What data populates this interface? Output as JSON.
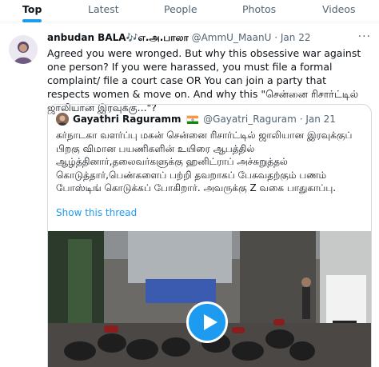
{
  "tabs": [
    {
      "label": "Top",
      "active": true
    },
    {
      "label": "Latest",
      "active": false
    },
    {
      "label": "People",
      "active": false
    },
    {
      "label": "Photos",
      "active": false
    },
    {
      "label": "Videos",
      "active": false
    }
  ],
  "tweet": {
    "name": "anbudan BALA🎶எ.அ.பாலா",
    "handle": "@AmmU_MaanU",
    "separator": "·",
    "date": "Jan 22",
    "more": "···",
    "text": "Agreed you were wronged. But why this obsessive war against one person? If you were harassed, you must file a formal complaint/ file a court case OR You can join a party that respects women & move on. And why this \"சென்னை ரிசார்ட்டில் ஜாலியான இரவுக்கு...\"?"
  },
  "quote": {
    "name": "Gayathri Raguramm",
    "handle": "@Gayatri_Raguram",
    "separator": "·",
    "date": "Jan 21",
    "text": "கர்நாடகா வளர்ப்பு மகன் சென்னை ரிசார்ட்டில் ஜாலியான இரவுக்குப் பிறகு விமான பயணிகளின் உயிரை ஆபத்தில் ஆழ்த்தினார்,தலைவர்களுக்கு ஹனிட்ராப் அச்சுறுத்தல் கொடுத்தார்,பெண்களைப் பற்றி தவறாகப் பேசுவதற்கும் பணம் போஸ்டிங் கொடுக்கப் போகிறார். அவருக்கு Z வகை பாதுகாப்பு.",
    "show_thread": "Show this thread"
  },
  "icons": {
    "play": "play-icon",
    "more": "more-icon",
    "flag": "india-flag-icon"
  },
  "colors": {
    "accent": "#1d9bf0",
    "text": "#0f1419",
    "secondary": "#536471",
    "border": "#cfd9de"
  }
}
